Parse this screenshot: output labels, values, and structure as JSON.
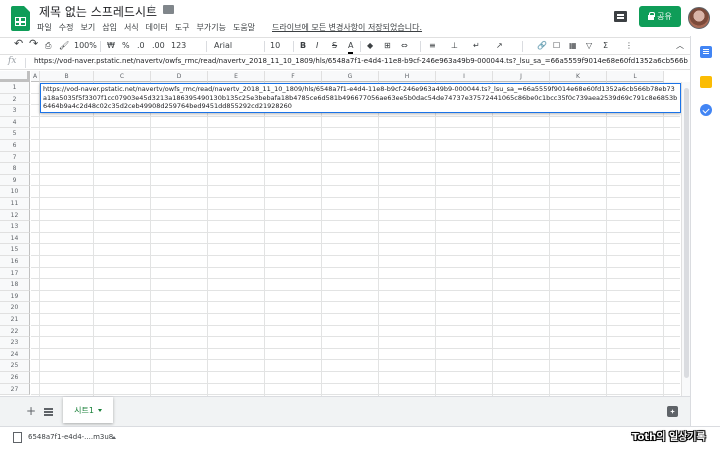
{
  "header": {
    "title": "제목 없는 스프레드시트",
    "save_status": "드라이브에 모든 변경사항이 저장되었습니다.",
    "share_label": "공유"
  },
  "menus": [
    "파일",
    "수정",
    "보기",
    "삽입",
    "서식",
    "데이터",
    "도구",
    "부가기능",
    "도움말"
  ],
  "toolbar": {
    "zoom": "100%",
    "currency": "₩",
    "percent": "%",
    "dec_decrease": ".0",
    "dec_increase": ".00",
    "more_formats": "123",
    "font": "Arial",
    "font_size": "10",
    "bold": "B",
    "italic": "I",
    "strike": "S",
    "text_color": "A",
    "more": "⋮",
    "collapse": "︿"
  },
  "formula_bar": {
    "fx_label": "fx",
    "content": "https://vod-naver.pstatic.net/navertv/owfs_rmc/read/navertv_2018_11_10_1809/hls/6548a7f1-e4d4-11e8-b9cf-246e963a49b9-000044.ts?_lsu_sa_=66a5559f9014e68e60fd1352a6cb566b78eb73a18a5035f5f3307f1cc07903e45d3213a186395490130b135c25e3bebafa18b4785ce6d581b496677056ae63ee5b0dac54de74737e37572441065c86be0c1bcc35f0c739aea2539d69c791c8e6853b6464b9a4c2d48c02c35d2ceb49908d259764bed9451dd855292cd21928260"
  },
  "grid": {
    "columns": [
      "A",
      "B",
      "C",
      "D",
      "E",
      "F",
      "G",
      "H",
      "I",
      "J",
      "K",
      "L"
    ],
    "rows": [
      "1",
      "2",
      "3",
      "4",
      "5",
      "6",
      "7",
      "8",
      "9",
      "10",
      "11",
      "12",
      "13",
      "14",
      "15",
      "16",
      "17",
      "18",
      "19",
      "20",
      "21",
      "22",
      "23",
      "24",
      "25",
      "26",
      "27"
    ],
    "active_cell_text": "https://vod-naver.pstatic.net/navertv/owfs_rmc/read/navertv_2018_11_10_1809/hls/6548a7f1-e4d4-11e8-b9cf-246e963a49b9-000044.ts?_lsu_sa_=66a5559f9014e68e60fd1352a6cb566b78eb73a18a5035f5f3307f1cc07903e45d3213a186395490130b135c25e3bebafa18b4785ce6d581b496677056ae63ee5b0dac54de74737e37572441065c86be0c1bcc35f0c739aea2539d69c791c8e6853b6464b9a4c2d48c02c35d2ceb49908d259764bed9451dd855292cd21928260"
  },
  "sheets": {
    "active_tab": "시트1"
  },
  "download": {
    "file_name": "6548a7f1-e4d4-....m3u8"
  },
  "watermark": "Toth의 일상기록",
  "colors": {
    "accent": "#0f9d58",
    "selection": "#1a73e8",
    "sheet_tab": "#188038"
  }
}
